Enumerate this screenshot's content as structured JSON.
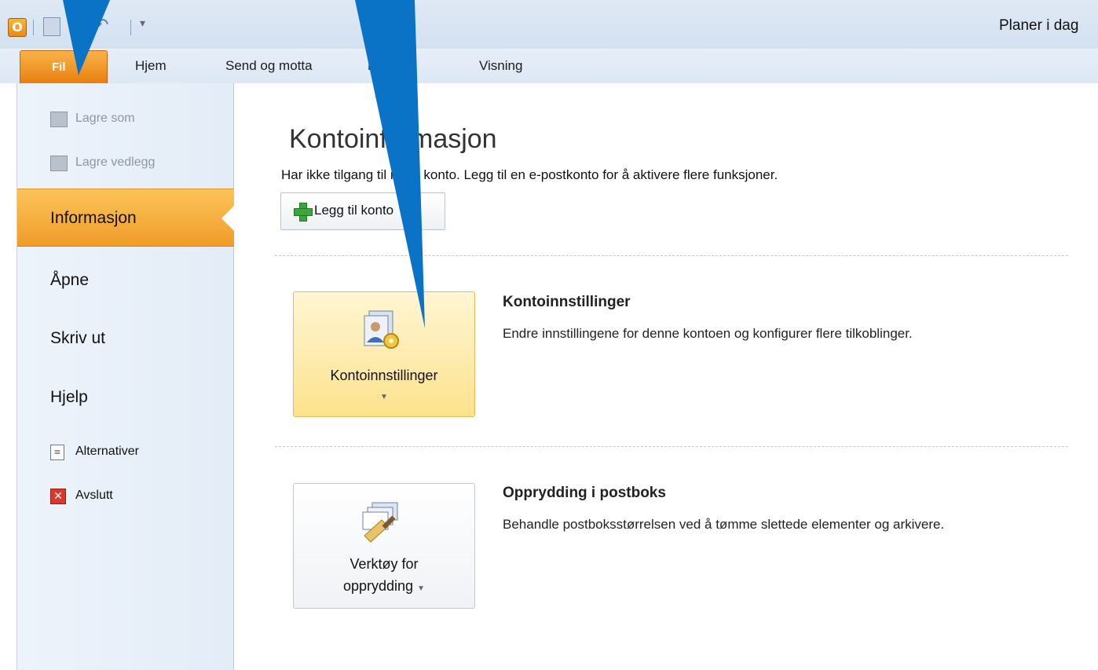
{
  "window": {
    "title": "Planer i dag"
  },
  "tabs": {
    "file": "Fil",
    "items": [
      "Hjem",
      "Send og motta",
      "Mappe",
      "Visning"
    ]
  },
  "sidebar": {
    "save_as": "Lagre som",
    "save_attachments": "Lagre vedlegg",
    "info": "Informasjon",
    "open": "Åpne",
    "print": "Skriv ut",
    "help": "Hjelp",
    "options": "Alternativer",
    "exit": "Avslutt"
  },
  "main": {
    "title": "Kontoinformasjon",
    "description": "Har ikke tilgang til noen konto. Legg til en e-postkonto for å aktivere flere funksjoner.",
    "add_account_label": "Legg til konto",
    "settings": {
      "button_label": "Kontoinnstillinger",
      "title": "Kontoinnstillinger",
      "description": "Endre innstillingene for denne kontoen og konfigurer flere tilkoblinger."
    },
    "cleanup": {
      "button_label_line1": "Verktøy for",
      "button_label_line2": "opprydding",
      "title": "Opprydding i postboks",
      "description": "Behandle postboksstørrelsen ved å tømme slettede elementer og arkivere."
    }
  },
  "icons": {
    "app": "outlook-app-icon",
    "save": "save-icon",
    "undo": "undo-icon",
    "add": "green-plus-icon",
    "settings": "account-settings-icon",
    "cleanup": "cleanup-tools-icon",
    "options": "options-icon",
    "exit": "exit-icon"
  },
  "colors": {
    "file_tab": "#e97f0e",
    "selected_nav": "#f19c27",
    "highlight_button": "#fde28d",
    "arrow": "#0b73c5"
  }
}
